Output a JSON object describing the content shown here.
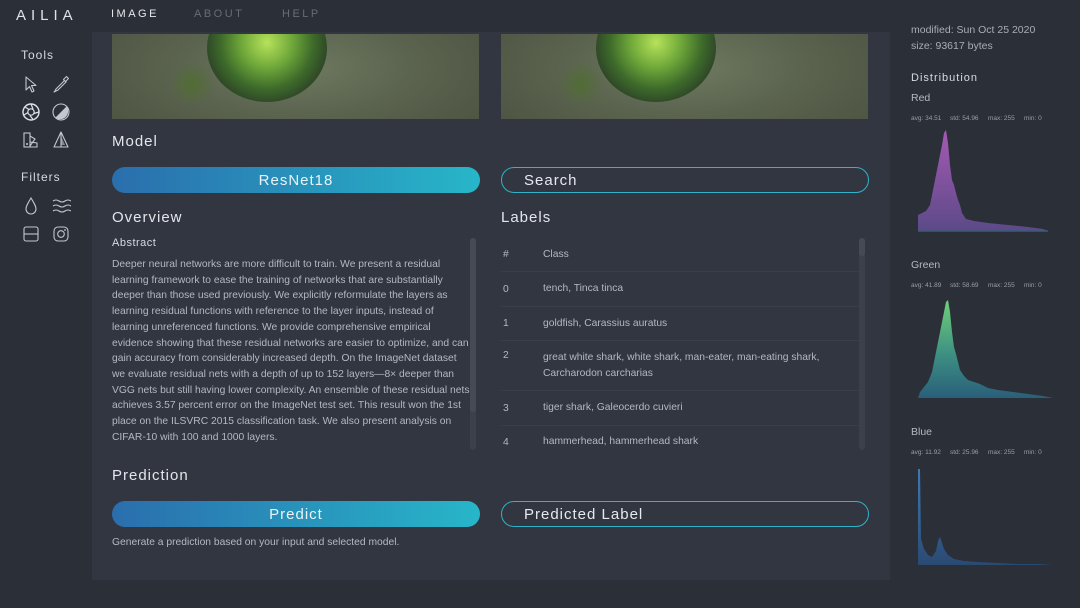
{
  "app": {
    "logo": "AILIA"
  },
  "nav": {
    "items": [
      {
        "label": "IMAGE"
      },
      {
        "label": "ABOUT"
      },
      {
        "label": "HELP"
      }
    ]
  },
  "sidebar": {
    "tools_title": "Tools",
    "filters_title": "Filters",
    "tools": [
      {
        "name": "pointer-icon"
      },
      {
        "name": "eyedropper-icon"
      },
      {
        "name": "aperture-icon"
      },
      {
        "name": "contrast-icon"
      },
      {
        "name": "color-swatch-icon"
      },
      {
        "name": "triangle-split-icon"
      }
    ],
    "filters": [
      {
        "name": "droplet-icon"
      },
      {
        "name": "waves-icon"
      },
      {
        "name": "frame-icon"
      },
      {
        "name": "instagram-icon"
      }
    ]
  },
  "model": {
    "title": "Model",
    "selected": "ResNet18",
    "search_label": "Search"
  },
  "overview": {
    "title": "Overview",
    "abstract_title": "Abstract",
    "abstract": "Deeper neural networks are more difficult to train. We present a residual learning framework to ease the training of networks that are substantially deeper than those used previously. We explicitly reformulate the layers as learning residual functions with reference to the layer inputs, instead of learning unreferenced functions. We provide comprehensive empirical evidence showing that these residual networks are easier to optimize, and can gain accuracy from considerably increased depth. On the ImageNet dataset we evaluate residual nets with a depth of up to 152 layers—8× deeper than VGG nets but still having lower complexity. An ensemble of these residual nets achieves 3.57 percent error on the ImageNet test set. This result won the 1st place on the ILSVRC 2015 classification task. We also present analysis on CIFAR-10 with 100 and 1000 layers."
  },
  "labels": {
    "title": "Labels",
    "columns": [
      "#",
      "Class"
    ],
    "rows": [
      {
        "num": "0",
        "cls": "tench, Tinca tinca"
      },
      {
        "num": "1",
        "cls": "goldfish, Carassius auratus"
      },
      {
        "num": "2",
        "cls": "great white shark, white shark, man-eater, man-eating shark, Carcharodon carcharias"
      },
      {
        "num": "3",
        "cls": "tiger shark, Galeocerdo cuvieri"
      },
      {
        "num": "4",
        "cls": "hammerhead, hammerhead shark"
      }
    ]
  },
  "prediction": {
    "title": "Prediction",
    "predict_label": "Predict",
    "result_label": "Predicted Label",
    "description": "Generate a prediction based on your input and selected model."
  },
  "file_info": {
    "modified": "modified: Sun Oct 25 2020",
    "size": "size: 93617 bytes"
  },
  "distribution": {
    "title": "Distribution",
    "channels": [
      {
        "name": "Red",
        "avg": "avg: 34.51",
        "std": "std: 54.96",
        "max": "max: 255",
        "min": "min: 0",
        "color_top": "#a05ab0",
        "color_bottom": "#6a4a8a"
      },
      {
        "name": "Green",
        "avg": "avg: 41.89",
        "std": "std: 58.69",
        "max": "max: 255",
        "min": "min: 0",
        "color_top": "#5fc07a",
        "color_bottom": "#2a6a7a"
      },
      {
        "name": "Blue",
        "avg": "avg: 11.92",
        "std": "std: 25.96",
        "max": "max: 255",
        "min": "min: 0",
        "color_top": "#3a78b0",
        "color_bottom": "#2a4f7a"
      }
    ]
  }
}
